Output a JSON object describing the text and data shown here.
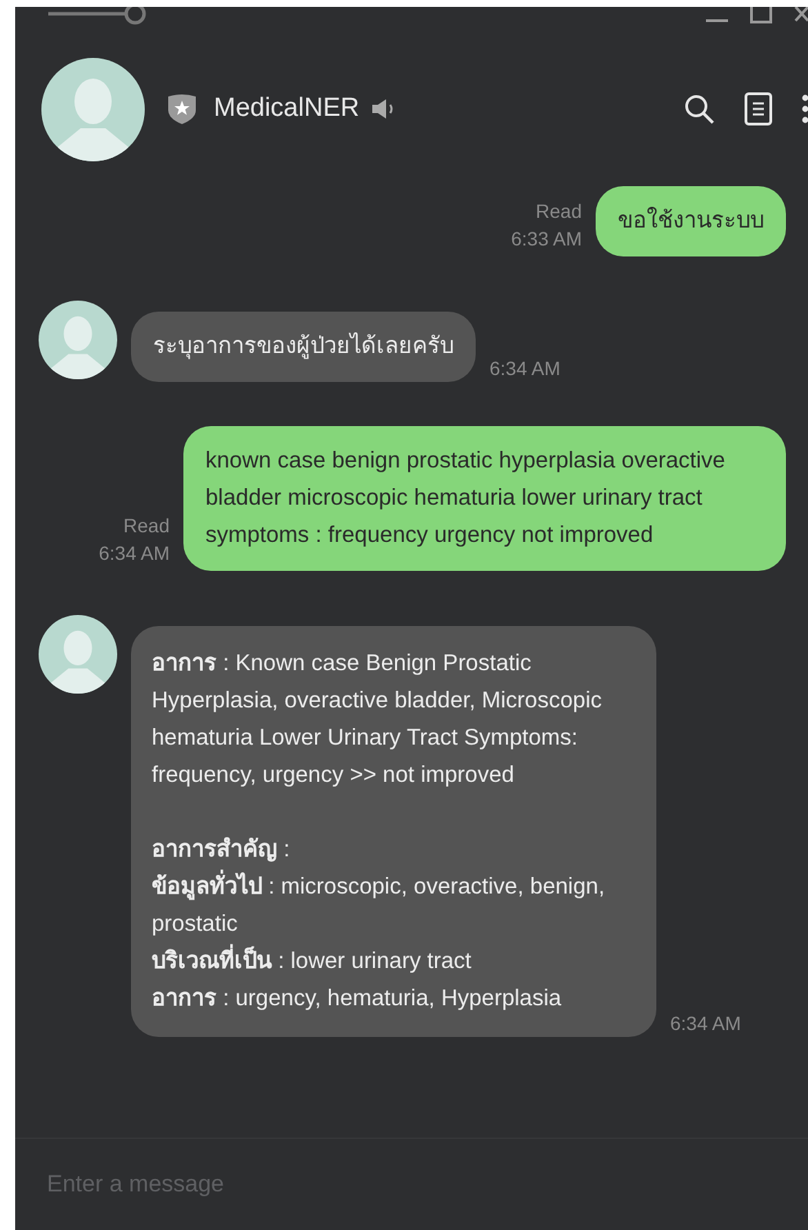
{
  "header": {
    "name": "MedicalNER"
  },
  "messages": [
    {
      "kind": "sent",
      "paragraphs": [
        [
          "ขอใช้งานระบบ"
        ]
      ],
      "read": "Read",
      "time": "6:33 AM"
    },
    {
      "kind": "received",
      "paragraphs": [
        [
          "ระบุอาการของผู้ป่วยได้เลยครับ"
        ]
      ],
      "time": "6:34 AM"
    },
    {
      "kind": "sent",
      "paragraphs": [
        [
          "known case benign prostatic hyperplasia overactive bladder microscopic hematuria lower urinary tract symptoms : frequency urgency not improved"
        ]
      ],
      "read": "Read",
      "time": "6:34 AM"
    },
    {
      "kind": "received",
      "paragraphs": [
        [
          "**อาการ** : Known case Benign Prostatic Hyperplasia, overactive bladder, Microscopic hematuria Lower Urinary Tract Symptoms: frequency, urgency >> not improved"
        ],
        [
          "**อาการสำคัญ** :",
          "**ข้อมูลทั่วไป** : microscopic, overactive, benign, prostatic",
          "**บริเวณที่เป็น** : lower urinary tract",
          "**อาการ** : urgency, hematuria, Hyperplasia"
        ]
      ],
      "time": "6:34 AM"
    }
  ],
  "composer": {
    "placeholder": "Enter a message"
  }
}
